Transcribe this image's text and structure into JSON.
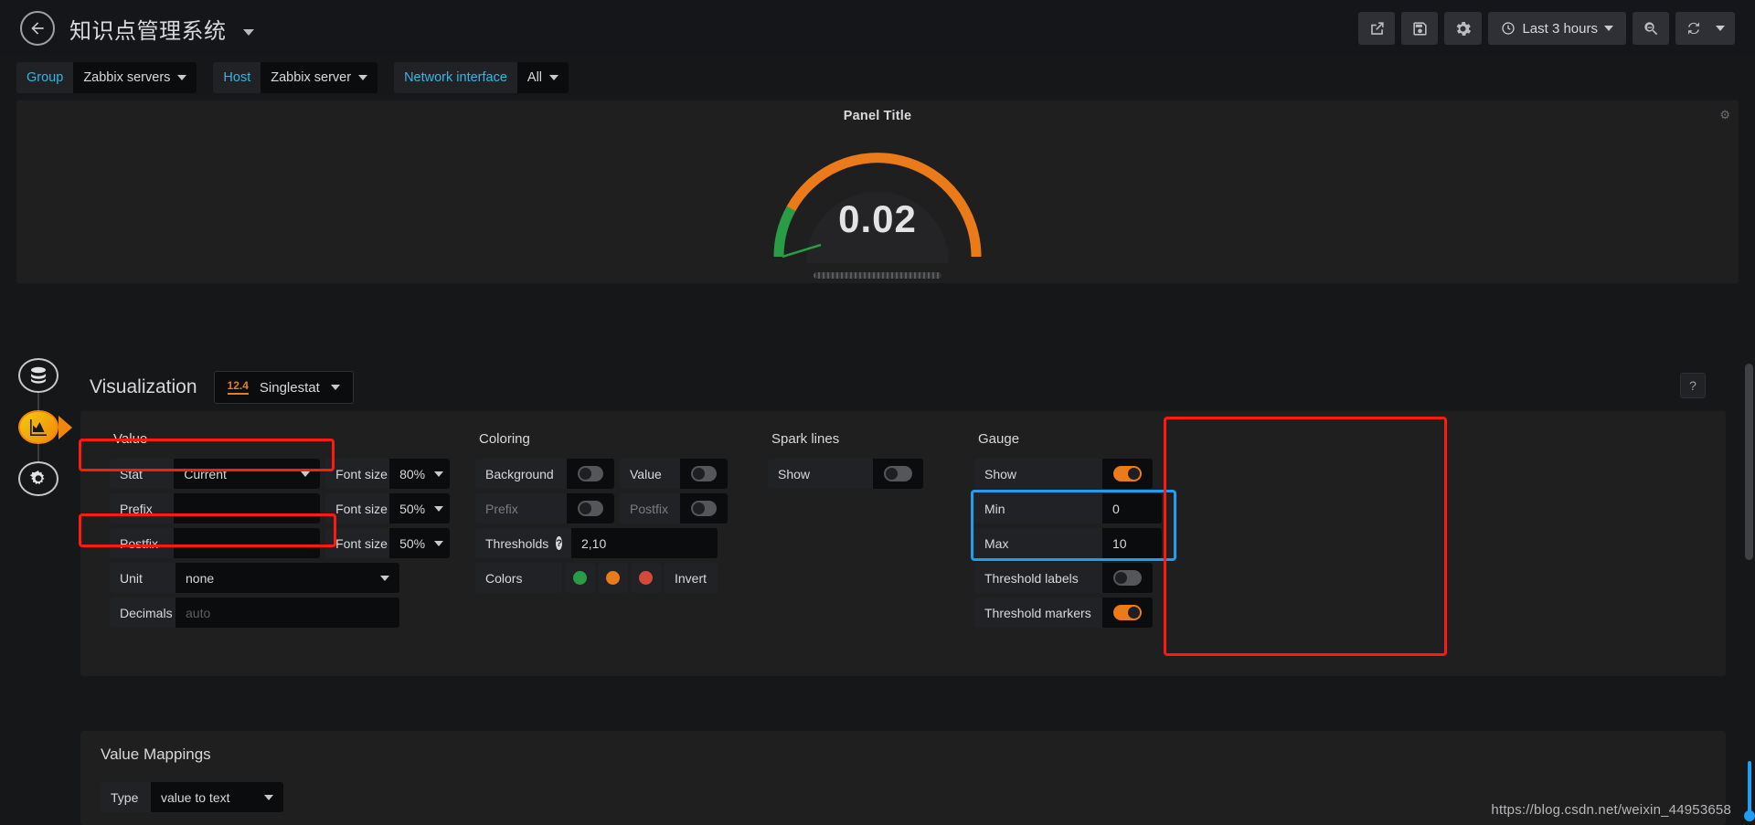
{
  "navbar": {
    "back_icon": "arrow-left-circle-icon",
    "title": "知识点管理系统",
    "share_icon": "share-icon",
    "save_icon": "save-icon",
    "settings_icon": "gear-icon",
    "time_range": "Last 3 hours",
    "clock_icon": "clock-icon",
    "zoom_out_icon": "zoom-out-icon",
    "refresh_icon": "refresh-icon"
  },
  "variables": [
    {
      "label": "Group",
      "value": "Zabbix servers"
    },
    {
      "label": "Host",
      "value": "Zabbix server"
    },
    {
      "label": "Network interface",
      "value": "All"
    }
  ],
  "panel": {
    "title": "Panel Title",
    "menu_icon": "panel-menu-icon",
    "value": "0.02"
  },
  "chart_data": {
    "type": "gauge",
    "title": "Panel Title",
    "value": 0.02,
    "display_value": "0.02",
    "min": 0,
    "max": 10,
    "thresholds": [
      2,
      10
    ],
    "threshold_colors": [
      "#299c46",
      "#eb7b18",
      "#d44a3a"
    ],
    "unit": "none",
    "decimals": "auto",
    "threshold_markers": true,
    "threshold_labels": false,
    "segments": [
      {
        "from": 0,
        "to": 2,
        "color": "#299c46",
        "label": "green"
      },
      {
        "from": 2,
        "to": 10,
        "color": "#eb7b18",
        "label": "orange"
      }
    ],
    "arc_start_deg": -90,
    "arc_end_deg": 90
  },
  "rail": [
    {
      "name": "queries",
      "icon": "database-icon",
      "active": false
    },
    {
      "name": "visualization",
      "icon": "chart-area-icon",
      "active": true
    },
    {
      "name": "general",
      "icon": "gear-wrench-icon",
      "active": false
    }
  ],
  "editor": {
    "heading": "Visualization",
    "viz_type": "Singlestat",
    "viz_badge": "12.4",
    "help_label": "?"
  },
  "value_section": {
    "title": "Value",
    "stat_label": "Stat",
    "stat_value": "Current",
    "prefix_label": "Prefix",
    "prefix_value": "",
    "postfix_label": "Postfix",
    "postfix_value": "",
    "unit_label": "Unit",
    "unit_value": "none",
    "decimals_label": "Decimals",
    "decimals_placeholder": "auto",
    "font_size_label": "Font size",
    "font_size_stat": "80%",
    "font_size_prefix": "50%",
    "font_size_postfix": "50%"
  },
  "coloring_section": {
    "title": "Coloring",
    "background_label": "Background",
    "background_on": false,
    "value_label": "Value",
    "value_on": false,
    "prefix_label": "Prefix",
    "prefix_on": false,
    "postfix_label": "Postfix",
    "postfix_on": false,
    "thresholds_label": "Thresholds",
    "thresholds_value": "2,10",
    "thresholds_help": "?",
    "colors_label": "Colors",
    "color_1": "#299c46",
    "color_2": "#eb7b18",
    "color_3": "#d44a3a",
    "invert_label": "Invert"
  },
  "sparklines_section": {
    "title": "Spark lines",
    "show_label": "Show",
    "show_on": false
  },
  "gauge_section": {
    "title": "Gauge",
    "show_label": "Show",
    "show_on": true,
    "min_label": "Min",
    "min_value": "0",
    "max_label": "Max",
    "max_value": "10",
    "threshold_labels_label": "Threshold labels",
    "threshold_labels_on": false,
    "threshold_markers_label": "Threshold markers",
    "threshold_markers_on": true
  },
  "value_mappings": {
    "title": "Value Mappings",
    "type_label": "Type",
    "type_value": "value to text"
  },
  "watermark": "https://blog.csdn.net/weixin_44953658",
  "colors": {
    "accent_orange": "#eb7b18",
    "accent_blue": "#33b5e5",
    "green": "#299c46",
    "red_annotation": "#ff1a10",
    "blue_annotation": "#1e9df1"
  }
}
